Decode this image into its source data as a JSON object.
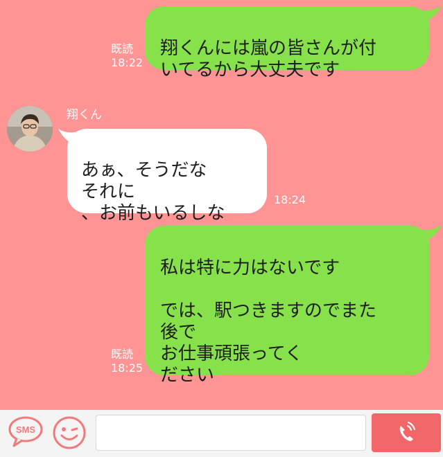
{
  "messages": [
    {
      "direction": "out",
      "text": "翔くんには嵐の皆さんが付\nいてるから大丈夫です",
      "read_label": "既読",
      "time": "18:22"
    },
    {
      "direction": "in",
      "sender": "翔くん",
      "text": "あぁ、そうだな\nそれに\n、お前もいるしな",
      "time": "18:24"
    },
    {
      "direction": "out",
      "text": "私は特に力はないです\n\nでは、駅つきますのでまた\n後で\nお仕事頑張ってく\nださい",
      "read_label": "既読",
      "time": "18:25"
    }
  ],
  "input_bar": {
    "sms_label": "SMS",
    "message_placeholder": "",
    "icons": [
      "sms-icon",
      "smiley-icon",
      "phone-icon"
    ]
  },
  "colors": {
    "chat_background": "#ff9494",
    "outgoing_bubble": "#86e14a",
    "incoming_bubble": "#ffffff",
    "call_button": "#f16666",
    "icon_accent": "#f27a7a"
  }
}
